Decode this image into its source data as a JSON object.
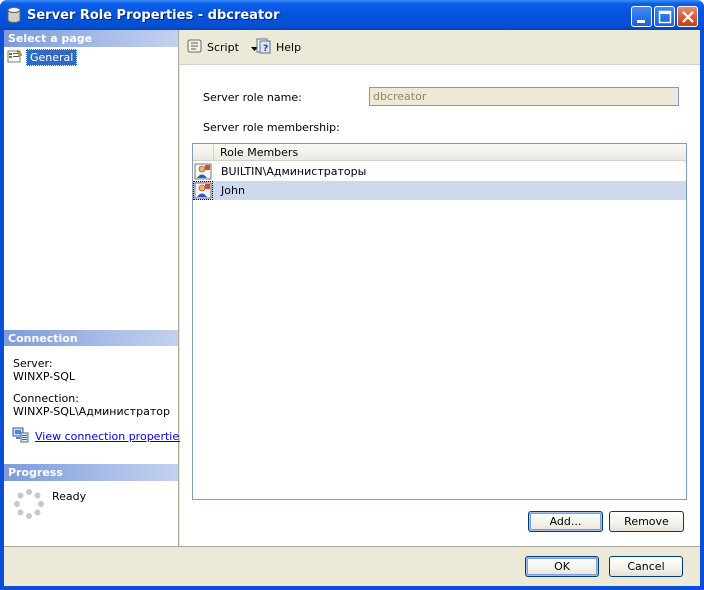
{
  "window": {
    "title": "Server Role Properties - dbcreator"
  },
  "left": {
    "select_page_header": "Select a page",
    "pages": [
      {
        "label": "General"
      }
    ],
    "connection_header": "Connection",
    "server_label": "Server:",
    "server_value": "WINXP-SQL",
    "connection_label": "Connection:",
    "connection_value": "WINXP-SQL\\Администратор",
    "view_link": "View connection properties",
    "progress_header": "Progress",
    "progress_status": "Ready"
  },
  "toolbar": {
    "script_label": "Script",
    "help_label": "Help"
  },
  "form": {
    "role_name_label": "Server role name:",
    "role_name_value": "dbcreator",
    "membership_label": "Server role membership:"
  },
  "grid": {
    "column_header": "Role Members",
    "rows": [
      {
        "name": "BUILTIN\\Администраторы"
      },
      {
        "name": "John"
      }
    ]
  },
  "buttons": {
    "add": "Add...",
    "remove": "Remove",
    "ok": "OK",
    "cancel": "Cancel"
  }
}
